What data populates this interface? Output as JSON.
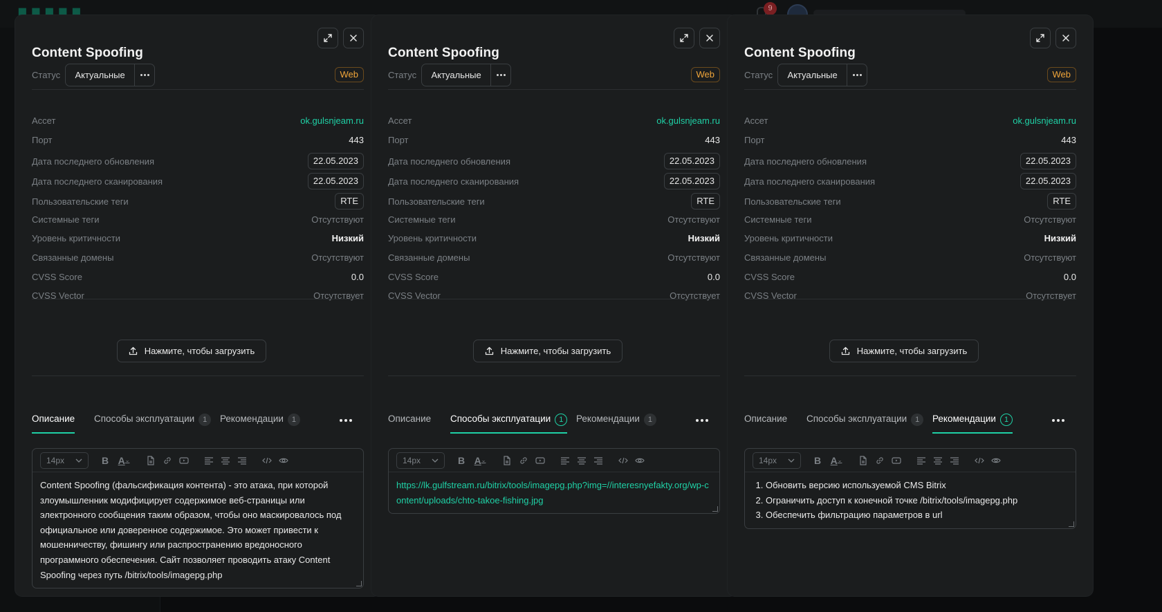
{
  "app": {
    "notification_count": "9"
  },
  "panels": [
    {
      "title": "Content Spoofing",
      "status_label": "Статус",
      "status_value": "Актуальные",
      "type_badge": "Web",
      "props": [
        {
          "label": "Ассет",
          "value": "ok.gulsnjeam.ru"
        },
        {
          "label": "Порт",
          "value": "443"
        },
        {
          "label": "Дата последнего обновления",
          "value": "22.05.2023"
        },
        {
          "label": "Дата последнего сканирования",
          "value": "22.05.2023"
        },
        {
          "label": "Пользовательские теги",
          "value": "RTE"
        },
        {
          "label": "Системные теги",
          "value": "Отсутствуют"
        },
        {
          "label": "Уровень критичности",
          "value": "Низкий"
        },
        {
          "label": "Связанные домены",
          "value": "Отсутствуют"
        },
        {
          "label": "CVSS Score",
          "value": "0.0"
        },
        {
          "label": "CVSS Vector",
          "value": "Отсутствует"
        }
      ],
      "upload_label": "Нажмите, чтобы загрузить",
      "tabs": [
        {
          "label": "Описание",
          "count": ""
        },
        {
          "label": "Способы эксплуатации",
          "count": "1"
        },
        {
          "label": "Рекомендации",
          "count": "1"
        }
      ],
      "active_tab": 0,
      "font_size": "14px",
      "content": "Content Spoofing (фальсификация контента) - это атака, при которой злоумышленник модифицирует содержимое веб-страницы или электронного сообщения таким образом, чтобы оно маскировалось под официальное или доверенное содержимое. Это может привести к мошенничеству, фишингу или распространению вредоносного программного обеспечения. Сайт позволяет проводить атаку Content Spoofing через путь /bitrix/tools/imagepg.php"
    },
    {
      "title": "Content Spoofing",
      "status_label": "Статус",
      "status_value": "Актуальные",
      "type_badge": "Web",
      "props": [
        {
          "label": "Ассет",
          "value": "ok.gulsnjeam.ru"
        },
        {
          "label": "Порт",
          "value": "443"
        },
        {
          "label": "Дата последнего обновления",
          "value": "22.05.2023"
        },
        {
          "label": "Дата последнего сканирования",
          "value": "22.05.2023"
        },
        {
          "label": "Пользовательские теги",
          "value": "RTE"
        },
        {
          "label": "Системные теги",
          "value": "Отсутствуют"
        },
        {
          "label": "Уровень критичности",
          "value": "Низкий"
        },
        {
          "label": "Связанные домены",
          "value": "Отсутствуют"
        },
        {
          "label": "CVSS Score",
          "value": "0.0"
        },
        {
          "label": "CVSS Vector",
          "value": "Отсутствует"
        }
      ],
      "upload_label": "Нажмите, чтобы загрузить",
      "tabs": [
        {
          "label": "Описание",
          "count": ""
        },
        {
          "label": "Способы эксплуатации",
          "count": "1"
        },
        {
          "label": "Рекомендации",
          "count": "1"
        }
      ],
      "active_tab": 1,
      "font_size": "14px",
      "content": "https://lk.gulfstream.ru/bitrix/tools/imagepg.php?img=//interesnyefakty.org/wp-content/uploads/chto-takoe-fishing.jpg"
    },
    {
      "title": "Content Spoofing",
      "status_label": "Статус",
      "status_value": "Актуальные",
      "type_badge": "Web",
      "props": [
        {
          "label": "Ассет",
          "value": "ok.gulsnjeam.ru"
        },
        {
          "label": "Порт",
          "value": "443"
        },
        {
          "label": "Дата последнего обновления",
          "value": "22.05.2023"
        },
        {
          "label": "Дата последнего сканирования",
          "value": "22.05.2023"
        },
        {
          "label": "Пользовательские теги",
          "value": "RTE"
        },
        {
          "label": "Системные теги",
          "value": "Отсутствуют"
        },
        {
          "label": "Уровень критичности",
          "value": "Низкий"
        },
        {
          "label": "Связанные домены",
          "value": "Отсутствуют"
        },
        {
          "label": "CVSS Score",
          "value": "0.0"
        },
        {
          "label": "CVSS Vector",
          "value": "Отсутствует"
        }
      ],
      "upload_label": "Нажмите, чтобы загрузить",
      "tabs": [
        {
          "label": "Описание",
          "count": ""
        },
        {
          "label": "Способы эксплуатации",
          "count": "1"
        },
        {
          "label": "Рекомендации",
          "count": "1"
        }
      ],
      "active_tab": 2,
      "font_size": "14px",
      "content_list": [
        "Обновить версию используемой CMS Bitrix",
        "Ограничить доступ к конечной точке /bitrix/tools/imagepg.php",
        "Обеспечить фильтрацию параметров в url"
      ]
    }
  ]
}
